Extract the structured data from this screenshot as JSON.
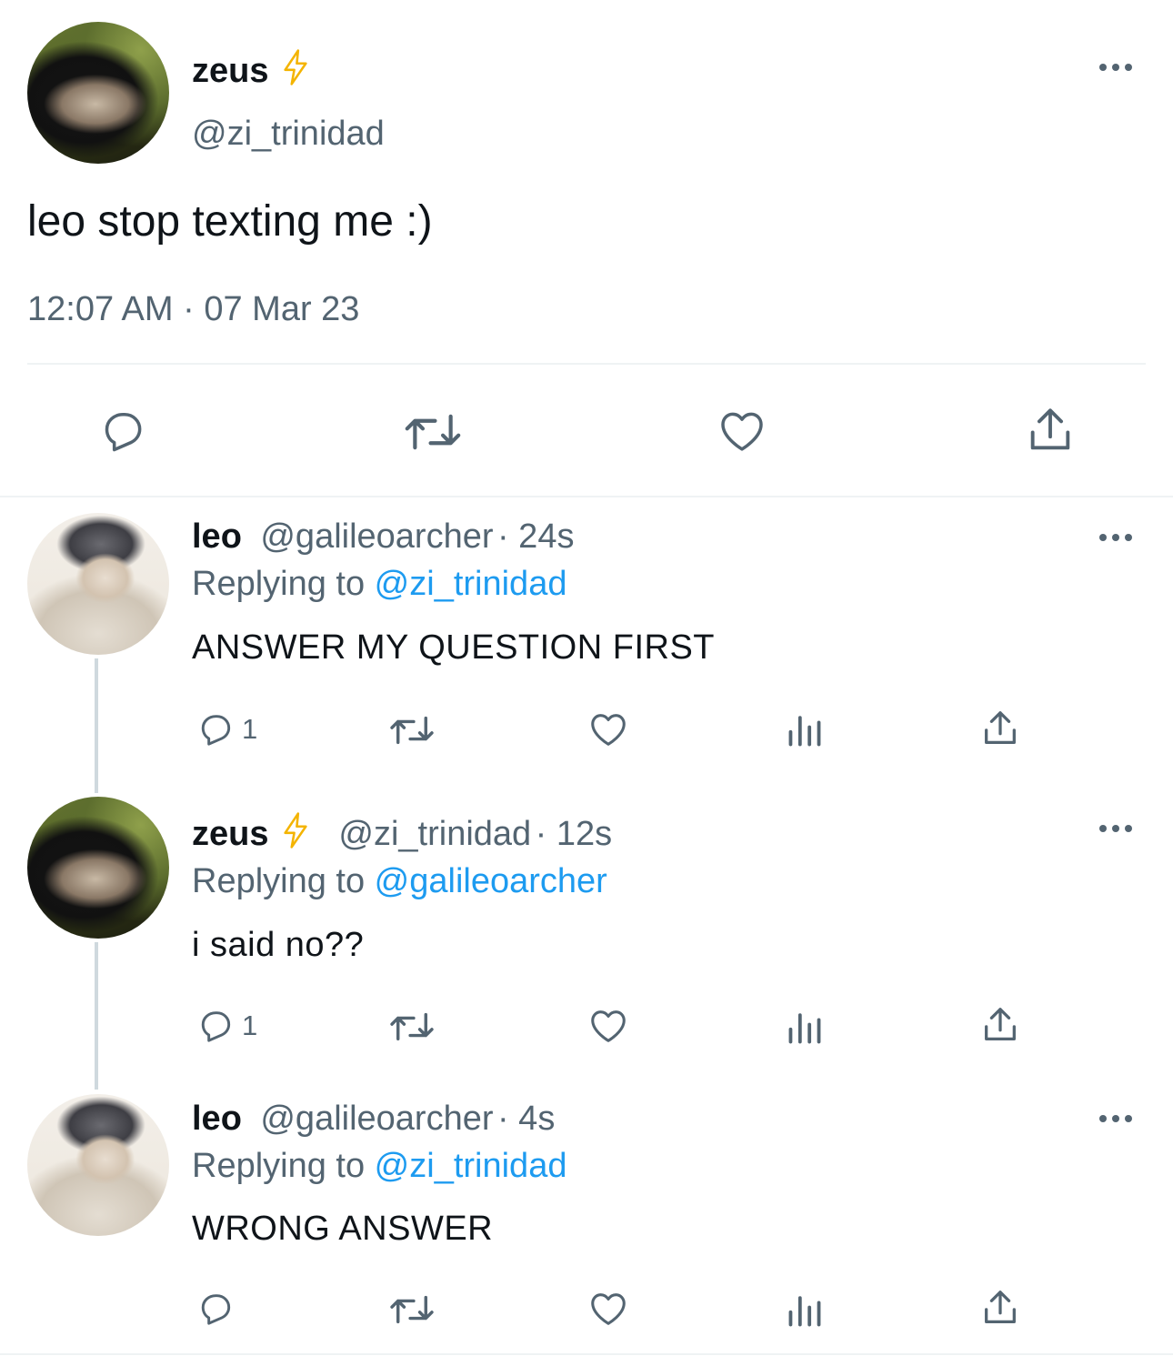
{
  "main_tweet": {
    "display_name": "zeus",
    "handle": "@zi_trinidad",
    "badge_icon": "lightning-bolt-icon",
    "text": "leo stop texting me :)",
    "time": "12:07 AM",
    "date_sep": "·",
    "date": "07 Mar 23",
    "actions": [
      "reply-icon",
      "retweet-icon",
      "like-icon",
      "share-icon"
    ]
  },
  "replies": [
    {
      "display_name": "leo",
      "handle": "@galileoarcher",
      "age": "· 24s",
      "replying_prefix": "Replying to ",
      "replying_to": "@zi_trinidad",
      "text": "ANSWER MY QUESTION FIRST",
      "reply_count": "1"
    },
    {
      "display_name": "zeus",
      "handle": "@zi_trinidad",
      "age": "· 12s",
      "replying_prefix": "Replying to ",
      "replying_to": "@galileoarcher",
      "text": "i said no??",
      "reply_count": "1"
    },
    {
      "display_name": "leo",
      "handle": "@galileoarcher",
      "age": "· 4s",
      "replying_prefix": "Replying to ",
      "replying_to": "@zi_trinidad",
      "text": "WRONG ANSWER",
      "reply_count": ""
    }
  ],
  "colors": {
    "text": "#0f1419",
    "secondary": "#536471",
    "link": "#1d9bf0",
    "bolt": "#f4b400",
    "divider": "#eff3f4",
    "thread_line": "#cfd9de"
  }
}
